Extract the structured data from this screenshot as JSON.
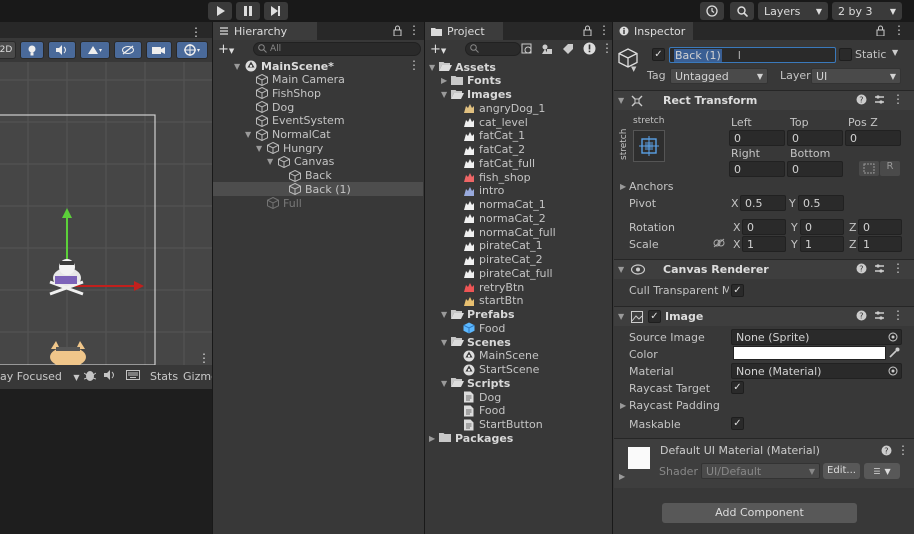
{
  "toolbar": {
    "play_icon": "play-icon",
    "pause_icon": "pause-icon",
    "step_icon": "step-icon",
    "layers_label": "Layers",
    "layout_label": "2 by 3"
  },
  "scene_toolbar": {
    "mode2d_label": "2D"
  },
  "game_bar": {
    "play_focused_label": "ay Focused",
    "stats_label": "Stats",
    "gizmos_label": "Gizmo"
  },
  "hierarchy": {
    "tab_label": "Hierarchy",
    "search_placeholder": "All",
    "items": [
      {
        "label": "MainScene*",
        "icon": "unity-scene-icon"
      },
      {
        "label": "Main Camera",
        "icon": "gameobject-icon"
      },
      {
        "label": "FishShop",
        "icon": "gameobject-icon"
      },
      {
        "label": "Dog",
        "icon": "gameobject-icon"
      },
      {
        "label": "EventSystem",
        "icon": "gameobject-icon"
      },
      {
        "label": "NormalCat",
        "icon": "gameobject-icon"
      },
      {
        "label": "Hungry",
        "icon": "gameobject-icon"
      },
      {
        "label": "Canvas",
        "icon": "gameobject-icon"
      },
      {
        "label": "Back",
        "icon": "gameobject-icon"
      },
      {
        "label": "Back (1)",
        "icon": "gameobject-icon"
      },
      {
        "label": "Full",
        "icon": "gameobject-icon"
      }
    ]
  },
  "project": {
    "tab_label": "Project",
    "items": [
      {
        "label": "Assets",
        "icon": "folder-open-icon"
      },
      {
        "label": "Fonts",
        "icon": "folder-icon"
      },
      {
        "label": "Images",
        "icon": "folder-open-icon"
      },
      {
        "label": "angryDog_1",
        "icon": "sprite-icon"
      },
      {
        "label": "cat_level",
        "icon": "sprite-icon"
      },
      {
        "label": "fatCat_1",
        "icon": "sprite-icon"
      },
      {
        "label": "fatCat_2",
        "icon": "sprite-icon"
      },
      {
        "label": "fatCat_full",
        "icon": "sprite-icon"
      },
      {
        "label": "fish_shop",
        "icon": "sprite-icon"
      },
      {
        "label": "intro",
        "icon": "sprite-icon"
      },
      {
        "label": "normaCat_1",
        "icon": "sprite-icon"
      },
      {
        "label": "normaCat_2",
        "icon": "sprite-icon"
      },
      {
        "label": "normaCat_full",
        "icon": "sprite-icon"
      },
      {
        "label": "pirateCat_1",
        "icon": "sprite-icon"
      },
      {
        "label": "pirateCat_2",
        "icon": "sprite-icon"
      },
      {
        "label": "pirateCat_full",
        "icon": "sprite-icon"
      },
      {
        "label": "retryBtn",
        "icon": "sprite-icon"
      },
      {
        "label": "startBtn",
        "icon": "sprite-icon"
      },
      {
        "label": "Prefabs",
        "icon": "folder-open-icon"
      },
      {
        "label": "Food",
        "icon": "prefab-icon"
      },
      {
        "label": "Scenes",
        "icon": "folder-open-icon"
      },
      {
        "label": "MainScene",
        "icon": "unity-scene-icon"
      },
      {
        "label": "StartScene",
        "icon": "unity-scene-icon"
      },
      {
        "label": "Scripts",
        "icon": "folder-open-icon"
      },
      {
        "label": "Dog",
        "icon": "script-icon"
      },
      {
        "label": "Food",
        "icon": "script-icon"
      },
      {
        "label": "StartButton",
        "icon": "script-icon"
      },
      {
        "label": "Packages",
        "icon": "folder-icon"
      }
    ]
  },
  "inspector": {
    "tab_label": "Inspector",
    "name_value": "Back (1)",
    "static_label": "Static",
    "tag_label": "Tag",
    "tag_value": "Untagged",
    "layer_label": "Layer",
    "layer_value": "UI",
    "rect_transform": {
      "title": "Rect Transform",
      "anchor_preset_top": "stretch",
      "anchor_preset_side": "stretch",
      "left_label": "Left",
      "top_label": "Top",
      "posz_label": "Pos Z",
      "left_value": "0",
      "top_value": "0",
      "posz_value": "0",
      "right_label": "Right",
      "bottom_label": "Bottom",
      "right_value": "0",
      "bottom_value": "0",
      "blueprint_label": "R",
      "anchors_label": "Anchors",
      "pivot_label": "Pivot",
      "pivot_x": "0.5",
      "pivot_y": "0.5",
      "rotation_label": "Rotation",
      "rot_x": "0",
      "rot_y": "0",
      "rot_z": "0",
      "scale_label": "Scale",
      "scale_x": "1",
      "scale_y": "1",
      "scale_z": "1",
      "x_label": "X",
      "y_label": "Y",
      "z_label": "Z"
    },
    "canvas_renderer": {
      "title": "Canvas Renderer",
      "cull_label": "Cull Transparent Me"
    },
    "image": {
      "title": "Image",
      "source_label": "Source Image",
      "source_value": "None (Sprite)",
      "color_label": "Color",
      "color_value": "#ffffff",
      "material_label": "Material",
      "material_value": "None (Material)",
      "raycast_target_label": "Raycast Target",
      "raycast_padding_label": "Raycast Padding",
      "maskable_label": "Maskable"
    },
    "material": {
      "title": "Default UI Material (Material)",
      "shader_label": "Shader",
      "shader_value": "UI/Default",
      "edit_label": "Edit..."
    },
    "add_component_label": "Add Component"
  }
}
